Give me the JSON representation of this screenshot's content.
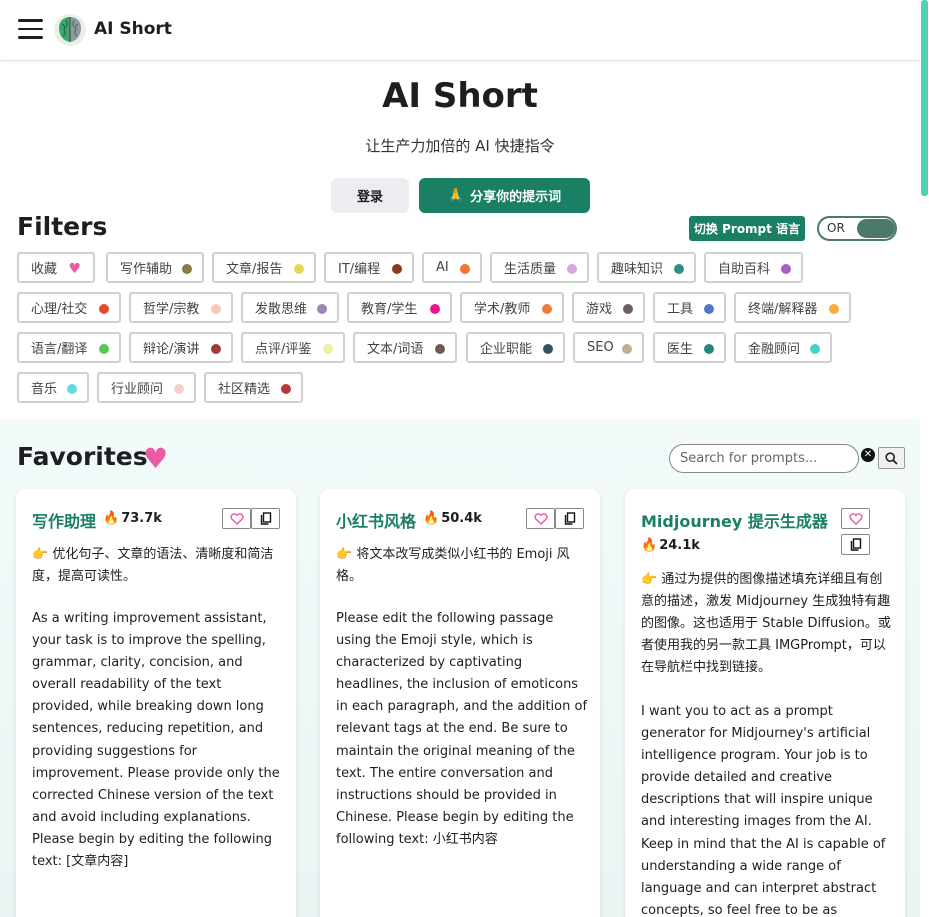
{
  "navbar": {
    "brand": "AI Short"
  },
  "hero": {
    "title": "AI Short",
    "subtitle": "让生产力加倍的 AI 快捷指令",
    "login_label": "登录",
    "share_label": "分享你的提示词"
  },
  "filters": {
    "title": "Filters",
    "lang_button": "切换 Prompt 语言",
    "toggle_label": "OR",
    "tags": [
      {
        "label": "收藏",
        "color": "#e95ba3"
      },
      {
        "label": "写作辅助",
        "color": "#8c7a3f"
      },
      {
        "label": "文章/报告",
        "color": "#e6d84e"
      },
      {
        "label": "IT/编程",
        "color": "#8b3a1f"
      },
      {
        "label": "AI",
        "color": "#f2752b"
      },
      {
        "label": "生活质量",
        "color": "#d9a6de"
      },
      {
        "label": "趣味知识",
        "color": "#2f8c88"
      },
      {
        "label": "自助百科",
        "color": "#a65fc2"
      },
      {
        "label": "心理/社交",
        "color": "#e84a2f"
      },
      {
        "label": "哲学/宗教",
        "color": "#f7c8bd"
      },
      {
        "label": "发散思维",
        "color": "#9a86b8"
      },
      {
        "label": "教育/学生",
        "color": "#e8178c"
      },
      {
        "label": "学术/教师",
        "color": "#f07a3a"
      },
      {
        "label": "游戏",
        "color": "#6b5e63"
      },
      {
        "label": "工具",
        "color": "#5377c4"
      },
      {
        "label": "终端/解释器",
        "color": "#f6ac3d"
      },
      {
        "label": "语言/翻译",
        "color": "#56c850"
      },
      {
        "label": "辩论/演讲",
        "color": "#a33a36"
      },
      {
        "label": "点评/评鉴",
        "color": "#edf0a3"
      },
      {
        "label": "文本/词语",
        "color": "#6e5a52"
      },
      {
        "label": "企业职能",
        "color": "#2f555f"
      },
      {
        "label": "SEO",
        "color": "#c6ab90"
      },
      {
        "label": "医生",
        "color": "#2a8480"
      },
      {
        "label": "金融顾问",
        "color": "#3dd6c9"
      },
      {
        "label": "音乐",
        "color": "#63dbe3"
      },
      {
        "label": "行业顾问",
        "color": "#f6cfcd"
      },
      {
        "label": "社区精选",
        "color": "#b8373e"
      }
    ]
  },
  "favorites": {
    "title": "Favorites",
    "search_placeholder": "Search for prompts...",
    "cards": [
      {
        "title": "写作助理",
        "count": "73.7k",
        "desc": "👉 优化句子、文章的语法、清晰度和简洁度，提高可读性。",
        "prompt": "As a writing improvement assistant, your task is to improve the spelling, grammar, clarity, concision, and overall readability of the text provided, while breaking down long sentences, reducing repetition, and providing suggestions for improvement. Please provide only the corrected Chinese version of the text and avoid including explanations. Please begin by editing the following text: [文章内容]"
      },
      {
        "title": "小红书风格",
        "count": "50.4k",
        "desc": "👉 将文本改写成类似小红书的 Emoji 风格。",
        "prompt": "Please edit the following passage using the Emoji style, which is characterized by captivating headlines, the inclusion of emoticons in each paragraph, and the addition of relevant tags at the end. Be sure to maintain the original meaning of the text. The entire conversation and instructions should be provided in Chinese. Please begin by editing the following text: 小红书内容"
      },
      {
        "title": "Midjourney 提示生成器",
        "count": "24.1k",
        "desc": "👉 通过为提供的图像描述填充详细且有创意的描述，激发 Midjourney 生成独特有趣的图像。这也适用于 Stable Diffusion。或者使用我的另一款工具 IMGPrompt，可以在导航栏中找到链接。",
        "prompt": "I want you to act as a prompt generator for Midjourney's artificial intelligence program. Your job is to provide detailed and creative descriptions that will inspire unique and interesting images from the AI. Keep in mind that the AI is capable of understanding a wide range of language and can interpret abstract concepts, so feel free to be as"
      }
    ]
  }
}
